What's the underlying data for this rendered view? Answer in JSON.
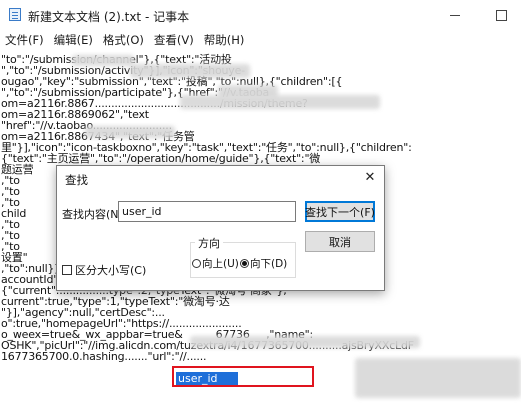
{
  "window": {
    "title": "新建文本文档 (2).txt - 记事本",
    "minimize_label": "",
    "maximize_label": ""
  },
  "menu": {
    "items": [
      {
        "label": "文件(F)"
      },
      {
        "label": "编辑(E)"
      },
      {
        "label": "格式(O)"
      },
      {
        "label": "查看(V)"
      },
      {
        "label": "帮助(H)"
      }
    ]
  },
  "editor": {
    "lines": [
      {
        "text": "\"to\":\"/submission/channel\"},{\"text\":\"活动投"
      },
      {
        "text": "\",\"to\":\"/submission/activity\"}],\"icon\":\"shouye-"
      },
      {
        "text": "ougao\",\"key\":\"submission\",\"text\":\"投稿\",\"to\":null},{\"children\":[{"
      },
      {
        "text": "\",\"to\":\"/submission/participate\"},{\"href\":\"//v.taoba"
      },
      {
        "text": "om=a2116r.8867....................................../mission/theme?"
      },
      {
        "text": "om=a2116r.8869062\",\"text"
      },
      {
        "text": "\"href\":\"//v.taobao........................"
      },
      {
        "text": "om=a2116r.8867434\",\"text\":\"任务管"
      },
      {
        "text": "里\"}],\"icon\":\"icon-taskboxno\",\"key\":\"task\",\"text\":\"任务\",\"to\":null},{\"children\":"
      },
      {
        "text": "{\"text\":\"主页运营\",\"to\":\"/operation/home/guide\"},{\"text\":\"微"
      },
      {
        "text": "题运营                                          /msg/guide\"},{\"text\":"
      },
      {
        "text": ",\"to                                           ext\":\"自运"
      },
      {
        "text": ",\"to                                           "
      },
      {
        "text": ",\"to                                           et\",\"text\":\"收益\"},"
      },
      {
        "text": "child                                          {\"text\":\"用户分"
      },
      {
        "text": ",\"to                                           "
      },
      {
        "text": ",\"to                                           ext\":\"统"
      },
      {
        "text": ",\"to                                           nt/status\"},{\"text\":\"财"
      },
      {
        "text": "设置\"                                           ent\",\"text\":\"账"
      },
      {
        "text": ",\"to\":null}]},\"punishData\":null,\"user\":"
      },
      {
        "text": "accountId\":1677365700\",\"accountTypes\":"
      },
      {
        "text": "{\"current\":...............type\":2,\"typeText\":\"微淘号·商家\"},"
      },
      {
        "text": "current\":true,\"type\":1,\"typeText\":\"微淘号·达"
      },
      {
        "text": "\"}],\"agency\":null,\"certDesc\":..."
      },
      {
        "text": "o\":true,\"homepageUrl\":\"https://......................"
      },
      {
        "text": "o_weex=true&_wx_appbar=true&          67736     ,\"name\":"
      },
      {
        "text": "OSHK\",\"picUrl\":\"//img.alicdn.com/tuzextra/i4/1677365700..........ajsBryXXcLdF"
      },
      {
        "text": "1677365700.0.hashing.......\"url\":\"//......"
      }
    ],
    "highlight_text": "user_id"
  },
  "find_dialog": {
    "title": "查找",
    "close_label": "✕",
    "find_label": "查找内容(N):",
    "find_value": "user_id",
    "find_next_label": "查找下一个(F)",
    "cancel_label": "取消",
    "direction_label": "方向",
    "up_label": "向上(U)",
    "down_label": "向下(D)",
    "case_label": "区分大小写(C)",
    "direction_selected": "down",
    "case_checked": false
  }
}
